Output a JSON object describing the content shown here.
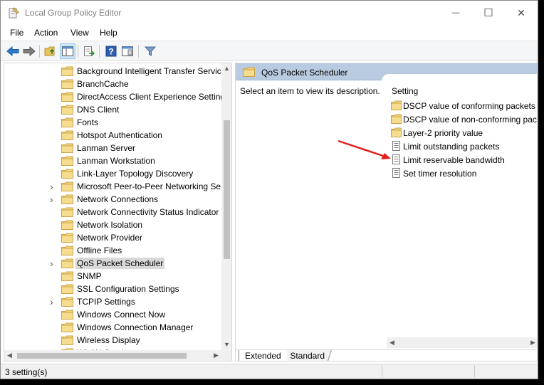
{
  "window": {
    "title": "Local Group Policy Editor",
    "controls": {
      "minimize": "—",
      "maximize": "☐",
      "close": "✕"
    }
  },
  "menu": [
    "File",
    "Action",
    "View",
    "Help"
  ],
  "toolbar": {
    "buttons": [
      "back-icon",
      "forward-icon",
      "up-folder-icon",
      "show-hide-tree-icon",
      "export-list-icon",
      "help-icon",
      "show-hide-action-pane-icon",
      "filter-icon"
    ]
  },
  "tree": {
    "items": [
      {
        "label": "Background Intelligent Transfer Service",
        "expandable": false,
        "selected": false
      },
      {
        "label": "BranchCache",
        "expandable": false,
        "selected": false
      },
      {
        "label": "DirectAccess Client Experience Settings",
        "expandable": false,
        "selected": false
      },
      {
        "label": "DNS Client",
        "expandable": false,
        "selected": false
      },
      {
        "label": "Fonts",
        "expandable": false,
        "selected": false
      },
      {
        "label": "Hotspot Authentication",
        "expandable": false,
        "selected": false
      },
      {
        "label": "Lanman Server",
        "expandable": false,
        "selected": false
      },
      {
        "label": "Lanman Workstation",
        "expandable": false,
        "selected": false
      },
      {
        "label": "Link-Layer Topology Discovery",
        "expandable": false,
        "selected": false
      },
      {
        "label": "Microsoft Peer-to-Peer Networking Services",
        "expandable": true,
        "selected": false
      },
      {
        "label": "Network Connections",
        "expandable": true,
        "selected": false
      },
      {
        "label": "Network Connectivity Status Indicator",
        "expandable": false,
        "selected": false
      },
      {
        "label": "Network Isolation",
        "expandable": false,
        "selected": false
      },
      {
        "label": "Network Provider",
        "expandable": false,
        "selected": false
      },
      {
        "label": "Offline Files",
        "expandable": false,
        "selected": false
      },
      {
        "label": "QoS Packet Scheduler",
        "expandable": true,
        "selected": true
      },
      {
        "label": "SNMP",
        "expandable": false,
        "selected": false
      },
      {
        "label": "SSL Configuration Settings",
        "expandable": false,
        "selected": false
      },
      {
        "label": "TCPIP Settings",
        "expandable": true,
        "selected": false
      },
      {
        "label": "Windows Connect Now",
        "expandable": false,
        "selected": false
      },
      {
        "label": "Windows Connection Manager",
        "expandable": false,
        "selected": false
      },
      {
        "label": "Wireless Display",
        "expandable": false,
        "selected": false
      },
      {
        "label": "WLAN Service",
        "expandable": false,
        "selected": false
      }
    ]
  },
  "details": {
    "header": "QoS Packet Scheduler",
    "description": "Select an item to view its description.",
    "column_header": "Setting",
    "settings": [
      {
        "label": "DSCP value of conforming packets",
        "type": "folder"
      },
      {
        "label": "DSCP value of non-conforming packets",
        "type": "folder"
      },
      {
        "label": "Layer-2 priority value",
        "type": "folder"
      },
      {
        "label": "Limit outstanding packets",
        "type": "policy"
      },
      {
        "label": "Limit reservable bandwidth",
        "type": "policy"
      },
      {
        "label": "Set timer resolution",
        "type": "policy"
      }
    ]
  },
  "tabs": [
    "Extended",
    "Standard"
  ],
  "status": {
    "text": "3 setting(s)"
  },
  "annotation": {
    "color": "#e3201b",
    "points_to": "Limit reservable bandwidth"
  }
}
